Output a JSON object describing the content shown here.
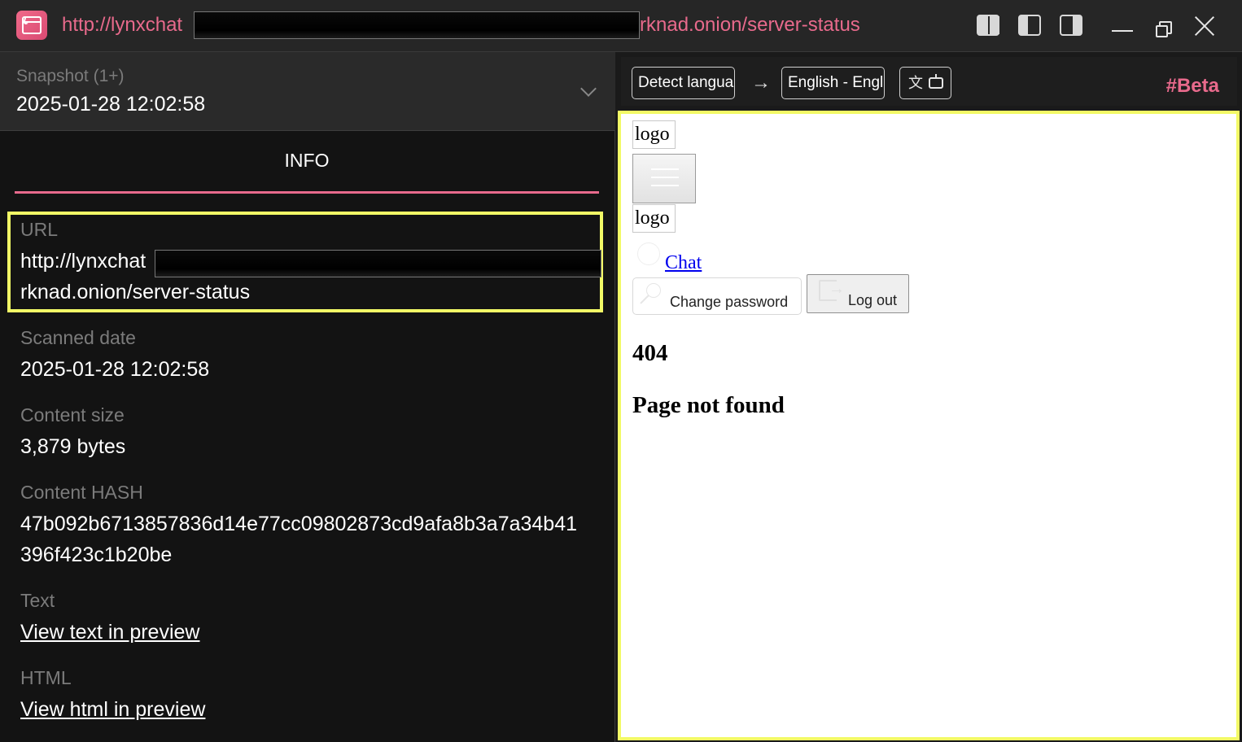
{
  "titlebar": {
    "url_start": "http://lynxchat",
    "url_end": "rknad.onion/server-status"
  },
  "snapshot": {
    "label": "Snapshot (1+)",
    "date": "2025-01-28 12:02:58"
  },
  "tab": {
    "label": "INFO"
  },
  "info": {
    "url_label": "URL",
    "url_line1": "http://lynxchat",
    "url_line2": "rknad.onion/server-status",
    "scanned_label": "Scanned date",
    "scanned_value": "2025-01-28 12:02:58",
    "size_label": "Content size",
    "size_value": "3,879 bytes",
    "hash_label": "Content HASH",
    "hash_line1": "47b092b6713857836d14e77cc09802873cd9afa8b3a7a34b41",
    "hash_line2": "396f423c1b20be",
    "text_label": "Text",
    "text_link": "View text in preview",
    "html_label": "HTML",
    "html_link": "View html in preview"
  },
  "translate": {
    "source": "Detect langua",
    "arrow": "→",
    "target": "English - Engl",
    "beta": "#Beta"
  },
  "preview": {
    "logo1": "logo",
    "logo2": "logo",
    "chat": "Chat",
    "change_password": "Change password",
    "log_out": "Log out",
    "heading_code": "404",
    "heading_msg": "Page not found"
  },
  "colors": {
    "accent": "#e86a8c",
    "highlight": "#f2fa66",
    "background": "#131313"
  }
}
